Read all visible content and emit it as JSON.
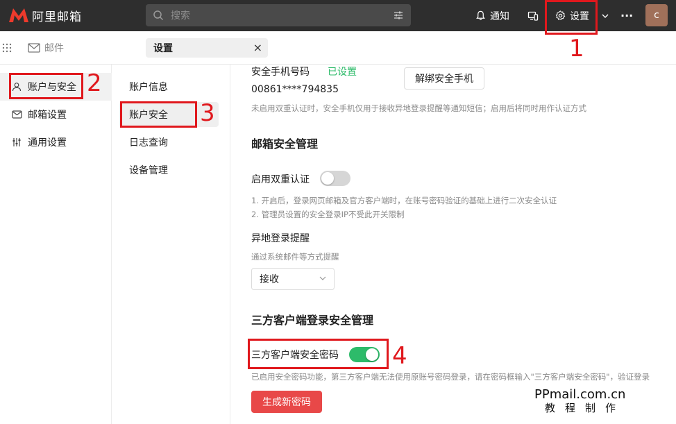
{
  "header": {
    "logo_text": "阿里邮箱",
    "search_placeholder": "搜索",
    "notify_label": "通知",
    "settings_label": "设置",
    "more_label": "···",
    "avatar_letter": "c"
  },
  "tabs": {
    "mail_label": "邮件",
    "settings_label": "设置",
    "close_label": "×"
  },
  "nav1": {
    "items": [
      {
        "label": "账户与安全",
        "icon": "user-icon"
      },
      {
        "label": "邮箱设置",
        "icon": "mailbox-icon"
      },
      {
        "label": "通用设置",
        "icon": "sliders-icon"
      }
    ]
  },
  "nav2": {
    "items": [
      {
        "label": "账户信息"
      },
      {
        "label": "账户安全"
      },
      {
        "label": "日志查询"
      },
      {
        "label": "设备管理"
      }
    ]
  },
  "content": {
    "phone_label": "安全手机号码",
    "phone_status": "已设置",
    "phone_number": "00861****794835",
    "unbind_button": "解绑安全手机",
    "phone_hint": "未启用双重认证时，安全手机仅用于接收异地登录提醒等通知短信；启用后将同时用作认证方式",
    "mailbox_security_title": "邮箱安全管理",
    "two_factor_label": "启用双重认证",
    "two_factor_on": false,
    "two_factor_note1": "1. 开启后，登录网页邮箱及官方客户端时，在账号密码验证的基础上进行二次安全认证",
    "two_factor_note2": "2. 管理员设置的安全登录IP不受此开关限制",
    "remote_login_label": "异地登录提醒",
    "remote_login_hint": "通过系统邮件等方式提醒",
    "remote_login_value": "接收",
    "third_party_title": "三方客户端登录安全管理",
    "third_party_pwd_label": "三方客户端安全密码",
    "third_party_pwd_on": true,
    "third_party_hint": "已启用安全密码功能，第三方客户端无法使用原账号密码登录，请在密码框输入\"三方客户端安全密码\"，验证登录",
    "generate_button": "生成新密码"
  },
  "annotations": {
    "n1": "1",
    "n2": "2",
    "n3": "3",
    "n4": "4"
  },
  "watermark": {
    "domain": "PPmail.com.cn",
    "caption": "教程制作"
  },
  "colors": {
    "topbar": "#2e2e2e",
    "accent_green": "#2dbb6a",
    "status_green": "#2dbb6a",
    "danger_red": "#e84848",
    "annotation_red": "#e0181d"
  }
}
